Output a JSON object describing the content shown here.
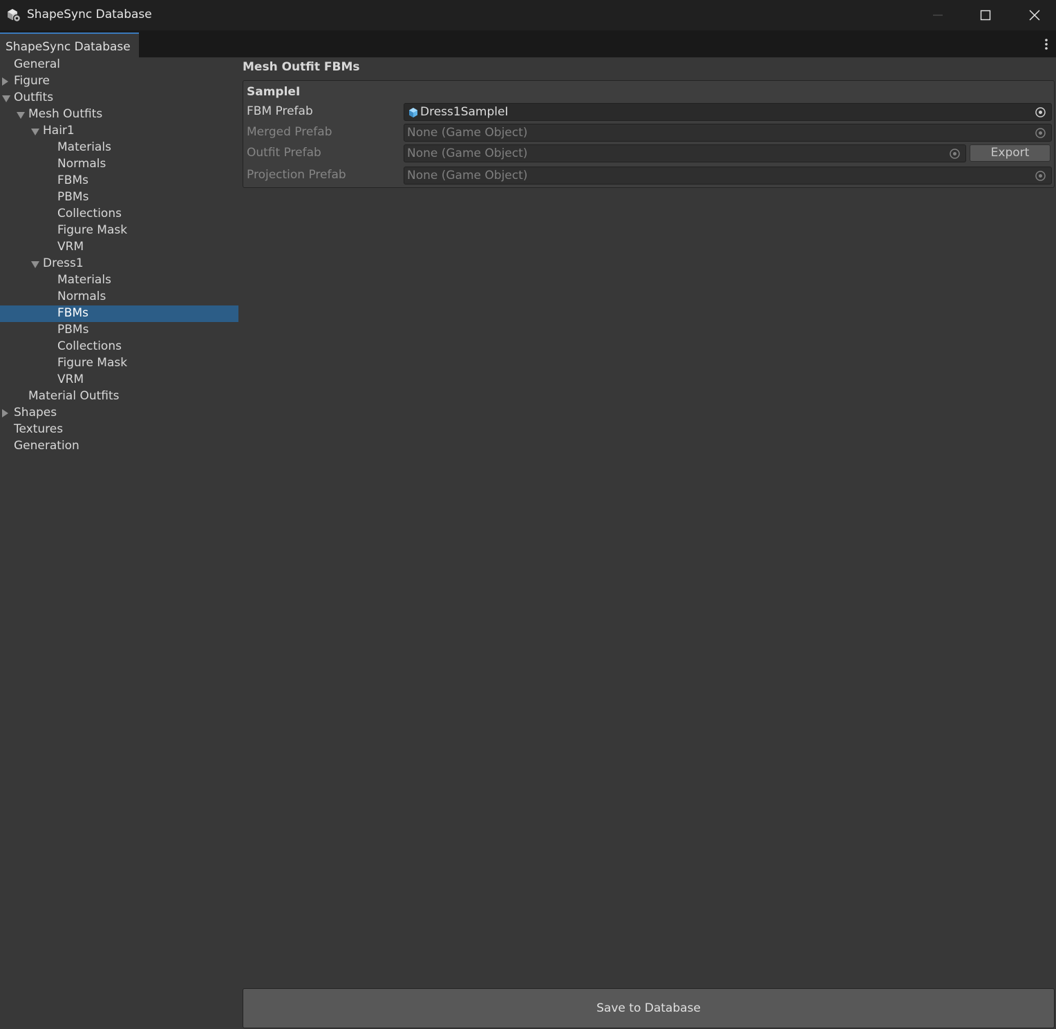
{
  "window": {
    "title": "ShapeSync Database",
    "app_icon": "unity-cube-gear-icon",
    "controls": [
      "minimize-icon",
      "maximize-icon",
      "close-icon"
    ]
  },
  "tab": {
    "label": "ShapeSync Database",
    "accent": "#3a79bb",
    "menu_icon": "kebab-menu-icon"
  },
  "sidebar": {
    "selected_color": "#2c5d87",
    "items": [
      {
        "label": "General"
      },
      {
        "label": "Figure",
        "arrow": "collapsed"
      },
      {
        "label": "Outfits",
        "arrow": "expanded"
      },
      {
        "label": "Mesh Outfits",
        "arrow": "expanded"
      },
      {
        "label": "Hair1",
        "arrow": "expanded"
      },
      {
        "label": "Materials"
      },
      {
        "label": "Normals"
      },
      {
        "label": "FBMs"
      },
      {
        "label": "PBMs"
      },
      {
        "label": "Collections"
      },
      {
        "label": "Figure Mask"
      },
      {
        "label": "VRM"
      },
      {
        "label": "Dress1",
        "arrow": "expanded"
      },
      {
        "label": "Materials"
      },
      {
        "label": "Normals"
      },
      {
        "label": "FBMs",
        "selected": true
      },
      {
        "label": "PBMs"
      },
      {
        "label": "Collections"
      },
      {
        "label": "Figure Mask"
      },
      {
        "label": "VRM"
      },
      {
        "label": "Material Outfits"
      },
      {
        "label": "Shapes",
        "arrow": "collapsed"
      },
      {
        "label": "Textures"
      },
      {
        "label": "Generation"
      }
    ]
  },
  "main": {
    "section_title": "Mesh Outfit FBMs",
    "group": {
      "title": "SampleI",
      "fields": {
        "fbm_prefab": {
          "label": "FBM Prefab",
          "value": "Dress1SampleI",
          "icon": "prefab-cube-icon"
        },
        "merged_prefab": {
          "label": "Merged Prefab",
          "value": "None (Game Object)"
        },
        "outfit_prefab": {
          "label": "Outfit Prefab",
          "value": "None (Game Object)"
        },
        "projection_prefab": {
          "label": "Projection Prefab",
          "value": "None (Game Object)"
        }
      },
      "export_label": "Export"
    },
    "save_label": "Save to Database"
  }
}
